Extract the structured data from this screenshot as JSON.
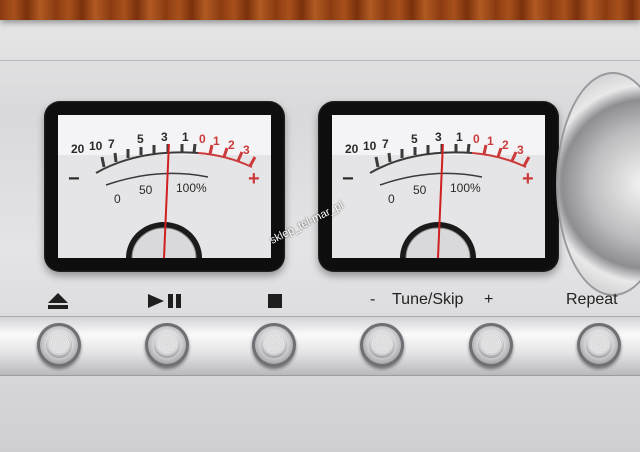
{
  "meters": [
    {
      "scale_left": [
        "20",
        "10",
        "7",
        "5",
        "3",
        "1"
      ],
      "scale_red": [
        "0",
        "1",
        "2",
        "3"
      ],
      "scale_percent": [
        "0",
        "50",
        "100%"
      ],
      "minus_sign": "−",
      "plus_sign": "+",
      "needle_level": 0.52
    },
    {
      "scale_left": [
        "20",
        "10",
        "7",
        "5",
        "3",
        "1"
      ],
      "scale_red": [
        "0",
        "1",
        "2",
        "3"
      ],
      "scale_percent": [
        "0",
        "50",
        "100%"
      ],
      "minus_sign": "−",
      "plus_sign": "+",
      "needle_level": 0.52
    }
  ],
  "watermark": "sklep_tel-mar_pl",
  "controls": {
    "tune_minus": "-",
    "tune_label": "Tune/Skip",
    "tune_plus": "+",
    "repeat_label": "Repeat"
  },
  "icons": {
    "eject": "eject-icon",
    "play_pause": "play-pause-icon",
    "stop": "stop-icon"
  },
  "colors": {
    "wood": "#9a4516",
    "meter_red": "#cc3b3b",
    "needle": "#d11f1f",
    "label_text": "#222222"
  }
}
